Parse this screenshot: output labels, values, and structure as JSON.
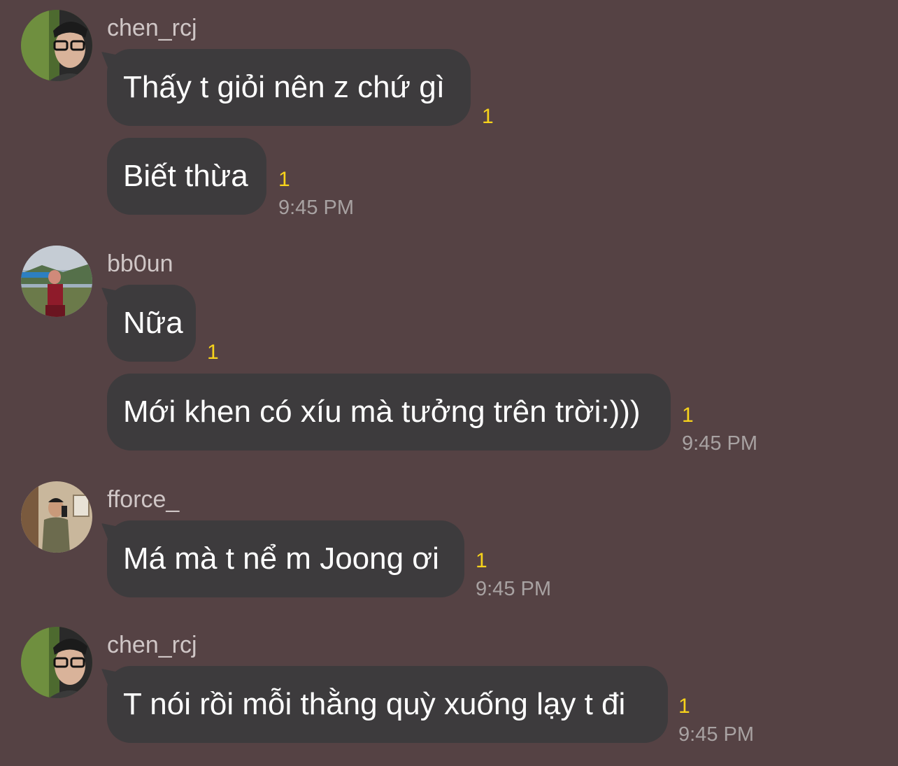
{
  "messages": [
    {
      "sender": "chen_rcj",
      "avatar": "chen_rcj-avatar-photo",
      "bubbles": [
        {
          "text": "Thấy t giỏi nên z chứ gì",
          "unread": "1",
          "time": ""
        },
        {
          "text": "Biết thừa",
          "unread": "1",
          "time": "9:45 PM"
        }
      ]
    },
    {
      "sender": "bb0un",
      "avatar": "bb0un-avatar-photo",
      "bubbles": [
        {
          "text": "Nữa",
          "unread": "1",
          "time": ""
        },
        {
          "text": "Mới khen có xíu mà tưởng trên trời:)))",
          "unread": "1",
          "time": "9:45 PM"
        }
      ]
    },
    {
      "sender": "fforce_",
      "avatar": "fforce_-avatar-photo",
      "bubbles": [
        {
          "text": "Má mà t nể m Joong ơi",
          "unread": "1",
          "time": "9:45 PM"
        }
      ]
    },
    {
      "sender": "chen_rcj",
      "avatar": "chen_rcj-avatar-photo",
      "bubbles": [
        {
          "text": "T nói rồi mỗi thằng quỳ xuống lạy t đi",
          "unread": "1",
          "time": "9:45 PM"
        }
      ]
    }
  ],
  "colors": {
    "background": "#554244",
    "bubble": "#3d3b3d",
    "unread": "#f7d31b",
    "time": "#a8a2a2",
    "sender": "#cfc6c6"
  }
}
